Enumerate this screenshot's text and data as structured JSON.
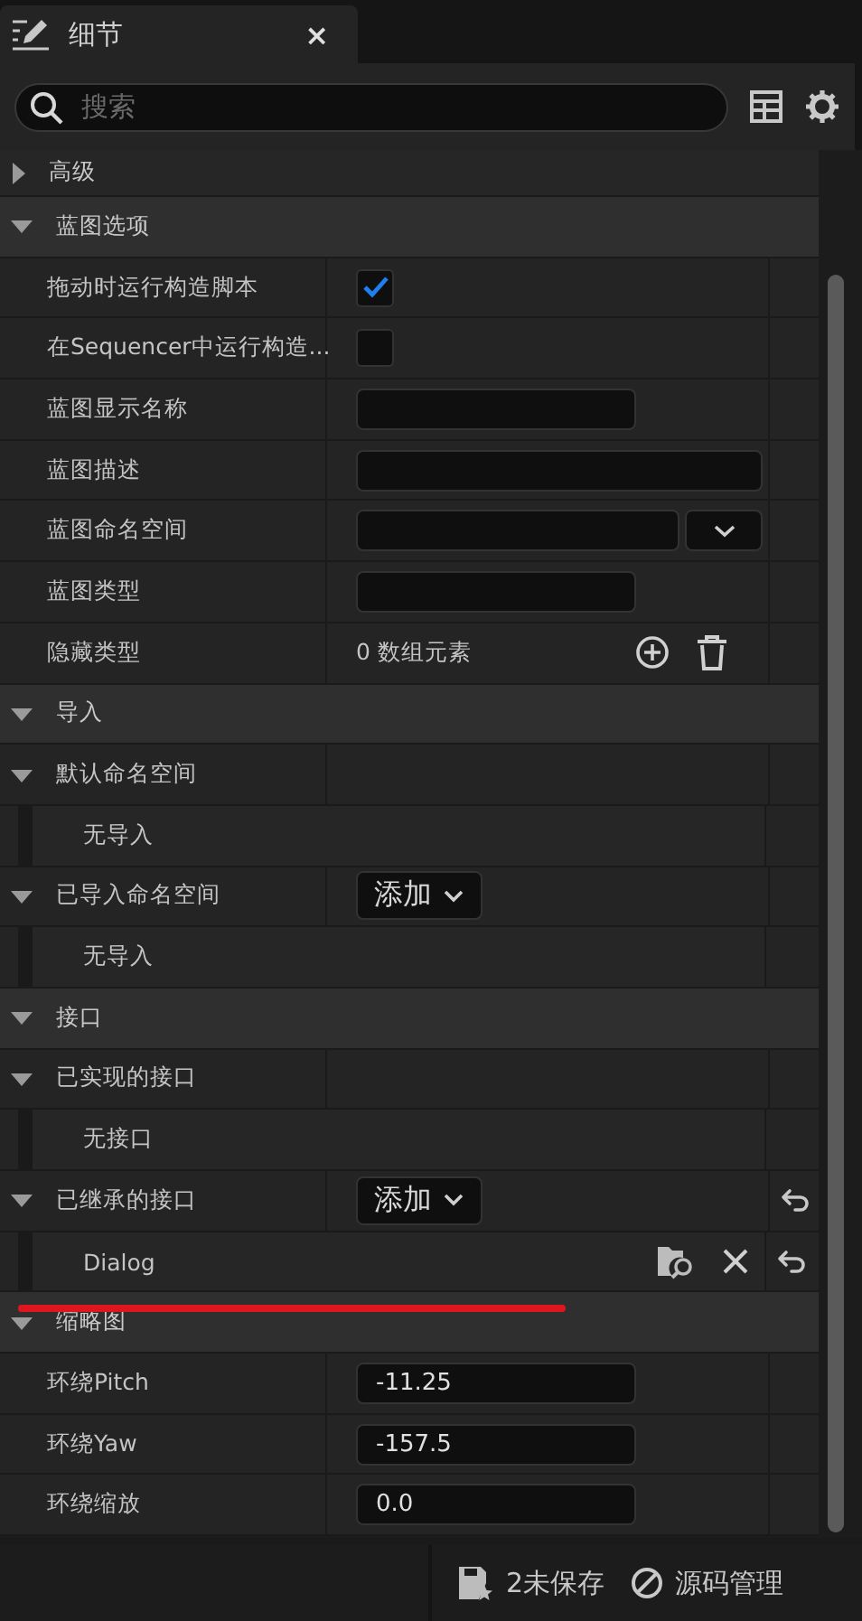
{
  "panel_tab": {
    "title": "细节",
    "close": "×"
  },
  "search": {
    "placeholder": "搜索"
  },
  "categories": [
    {
      "title": "高级",
      "expanded": false
    },
    {
      "title": "蓝图选项",
      "expanded": true,
      "children": [
        {
          "kind": "checkbox",
          "label": "拖动时运行构造脚本",
          "checked": true
        },
        {
          "kind": "checkbox",
          "label": "在Sequencer中运行构造...",
          "checked": false
        },
        {
          "kind": "field",
          "label": "蓝图显示名称"
        },
        {
          "kind": "wide_field",
          "label": "蓝图描述"
        },
        {
          "kind": "combo_field",
          "label": "蓝图命名空间"
        },
        {
          "kind": "field",
          "label": "蓝图类型"
        },
        {
          "kind": "array",
          "label": "隐藏类型",
          "value": "0 数组元素"
        }
      ]
    },
    {
      "title": "导入",
      "expanded": true,
      "children": [
        {
          "kind": "group",
          "label": "默认命名空间",
          "expanded": true,
          "children": [
            {
              "kind": "note",
              "label": "无导入"
            }
          ]
        },
        {
          "kind": "group",
          "label": "已导入命名空间",
          "expanded": true,
          "add": "添加",
          "children": [
            {
              "kind": "note",
              "label": "无导入"
            }
          ]
        }
      ]
    },
    {
      "title": "接口",
      "expanded": true,
      "children": [
        {
          "kind": "group",
          "label": "已实现的接口",
          "expanded": true,
          "children": [
            {
              "kind": "note",
              "label": "无接口"
            }
          ]
        },
        {
          "kind": "group",
          "label": "已继承的接口",
          "expanded": true,
          "add": "添加",
          "reset": true,
          "children": [
            {
              "kind": "item",
              "label": "Dialog",
              "reset": true
            }
          ]
        }
      ]
    },
    {
      "title": "缩略图",
      "expanded": true,
      "struck": true,
      "children": [
        {
          "kind": "field",
          "label": "环绕Pitch",
          "value": "-11.25"
        },
        {
          "kind": "field",
          "label": "环绕Yaw",
          "value": "-157.5"
        },
        {
          "kind": "field",
          "label": "环绕缩放",
          "value": "0.0"
        }
      ]
    }
  ],
  "status_bar": {
    "unsaved": "2未保存",
    "source_control": "源码管理"
  }
}
